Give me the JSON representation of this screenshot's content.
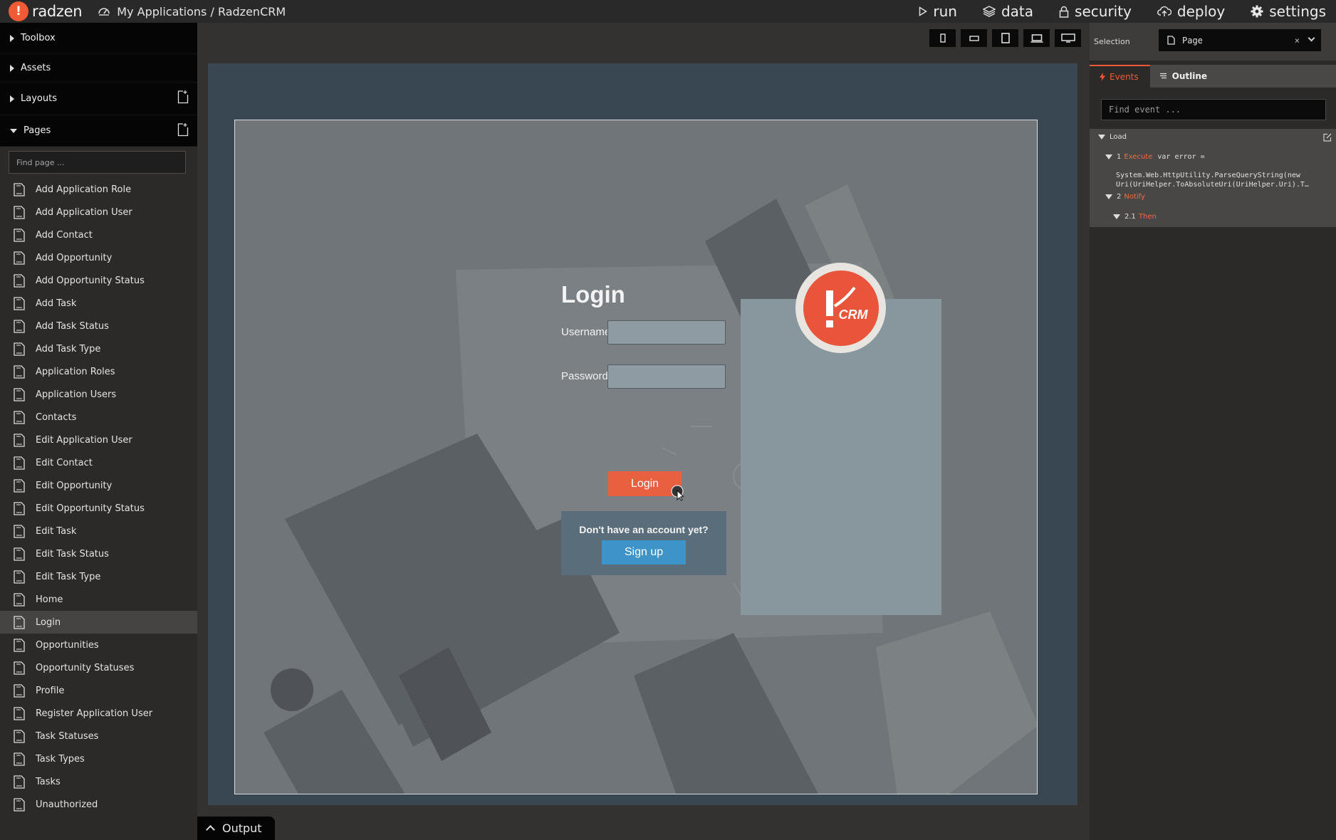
{
  "topbar": {
    "logo_letter": "!",
    "logo_text": "radzen",
    "breadcrumb": "My Applications / RadzenCRM",
    "nav": [
      {
        "label": "run",
        "icon": "play-icon"
      },
      {
        "label": "data",
        "icon": "layers-icon"
      },
      {
        "label": "security",
        "icon": "lock-icon"
      },
      {
        "label": "deploy",
        "icon": "cloud-upload-icon"
      },
      {
        "label": "settings",
        "icon": "gear-icon"
      }
    ]
  },
  "sidebar": {
    "sections": {
      "toolbox": "Toolbox",
      "assets": "Assets",
      "layouts": "Layouts",
      "pages": "Pages"
    },
    "search_placeholder": "Find page ...",
    "pages": [
      "Add Application Role",
      "Add Application User",
      "Add Contact",
      "Add Opportunity",
      "Add Opportunity Status",
      "Add Task",
      "Add Task Status",
      "Add Task Type",
      "Application Roles",
      "Application Users",
      "Contacts",
      "Edit Application User",
      "Edit Contact",
      "Edit Opportunity",
      "Edit Opportunity Status",
      "Edit Task",
      "Edit Task Status",
      "Edit Task Type",
      "Home",
      "Login",
      "Opportunities",
      "Opportunity Statuses",
      "Profile",
      "Register Application User",
      "Task Statuses",
      "Task Types",
      "Tasks",
      "Unauthorized"
    ],
    "active_page": "Login"
  },
  "viewport_buttons": [
    "phone-portrait-icon",
    "phone-landscape-icon",
    "tablet-icon",
    "laptop-icon",
    "desktop-icon"
  ],
  "login_page": {
    "logo_text": "CRM",
    "title": "Login",
    "username_label": "Username",
    "password_label": "Password",
    "login_button": "Login",
    "signup_prompt": "Don't have an account yet?",
    "signup_button": "Sign up"
  },
  "output_tab": "Output",
  "right_panel": {
    "selection_label": "Selection",
    "selection_value": "Page",
    "selection_clear": "×",
    "tabs": [
      "Events",
      "Outline"
    ],
    "find_placeholder": "Find event ...",
    "events": {
      "load": "Load",
      "step1_num": "1",
      "step1_type": "Execute",
      "step1_code": "var error =",
      "step1_code_more": "System.Web.HttpUtility.ParseQueryString(new\nUri(UriHelper.ToAbsoluteUri(UriHelper.Uri).T…",
      "step2_num": "2",
      "step2_type": "Notify",
      "step21_num": "2.1",
      "step21_type": "Then"
    }
  },
  "colors": {
    "accent": "#ef5b35",
    "signup_blue": "#3e93c7",
    "canvas_frame": "#394752"
  }
}
